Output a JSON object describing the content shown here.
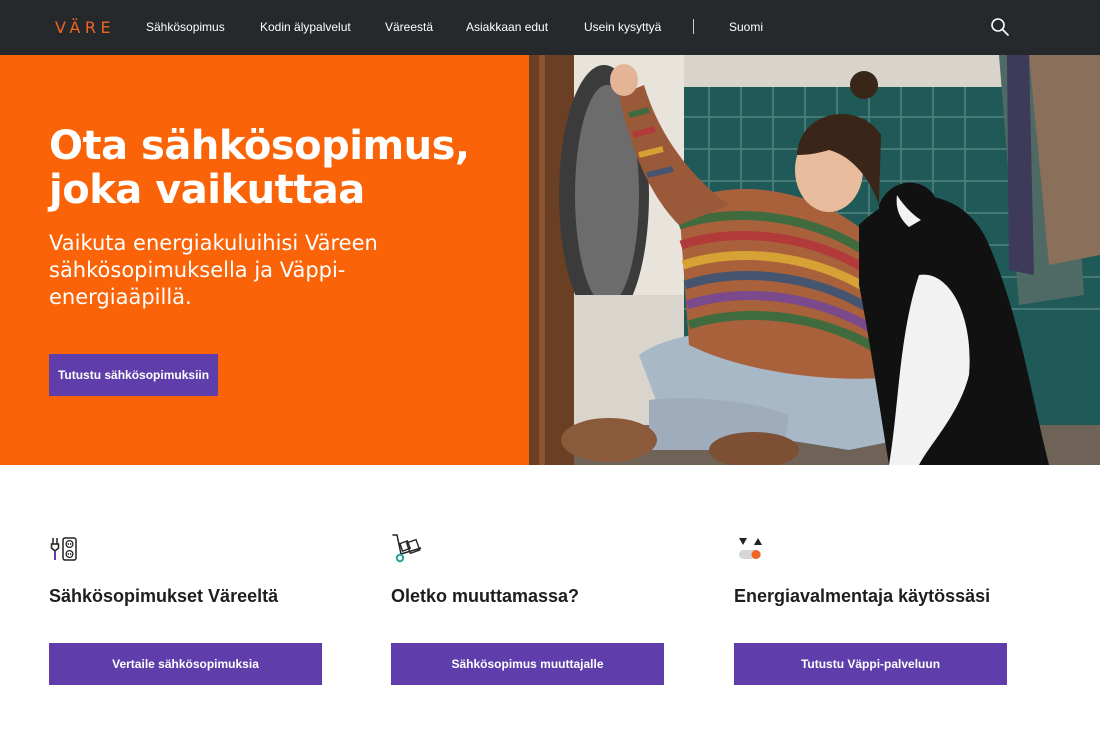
{
  "header": {
    "logo_text": "VÄRE",
    "nav": [
      {
        "label": "Sähkösopimus"
      },
      {
        "label": "Kodin älypalvelut"
      },
      {
        "label": "Väreestä"
      },
      {
        "label": "Asiakkaan edut"
      },
      {
        "label": "Usein kysyttyä"
      }
    ],
    "language": "Suomi",
    "search_icon": "search-icon"
  },
  "hero": {
    "title": "Ota sähkösopimus, joka vaikuttaa",
    "subtitle": "Vaikuta energiakuluihisi Väreen sähkösopimuksella ja Väppi-energiaäpillä.",
    "cta_label": "Tutustu sähkösopimuksiin",
    "image": "woman-with-dog-at-washing-machine-photo"
  },
  "features": [
    {
      "icon": "power-outlet-icon",
      "title": "Sähkösopimukset Väreeltä",
      "button_label": "Vertaile sähkösopimuksia"
    },
    {
      "icon": "hand-truck-icon",
      "title": "Oletko muuttamassa?",
      "button_label": "Sähkösopimus muuttajalle"
    },
    {
      "icon": "energy-coach-icon",
      "title": "Energiavalmentaja käytössäsi",
      "button_label": "Tutustu Väppi-palveluun"
    }
  ],
  "colors": {
    "header_bg": "#26292b",
    "brand_orange": "#fa6307",
    "logo_orange": "#f26322",
    "button_purple": "#5f3eab",
    "icon_teal": "#1aa99a"
  }
}
